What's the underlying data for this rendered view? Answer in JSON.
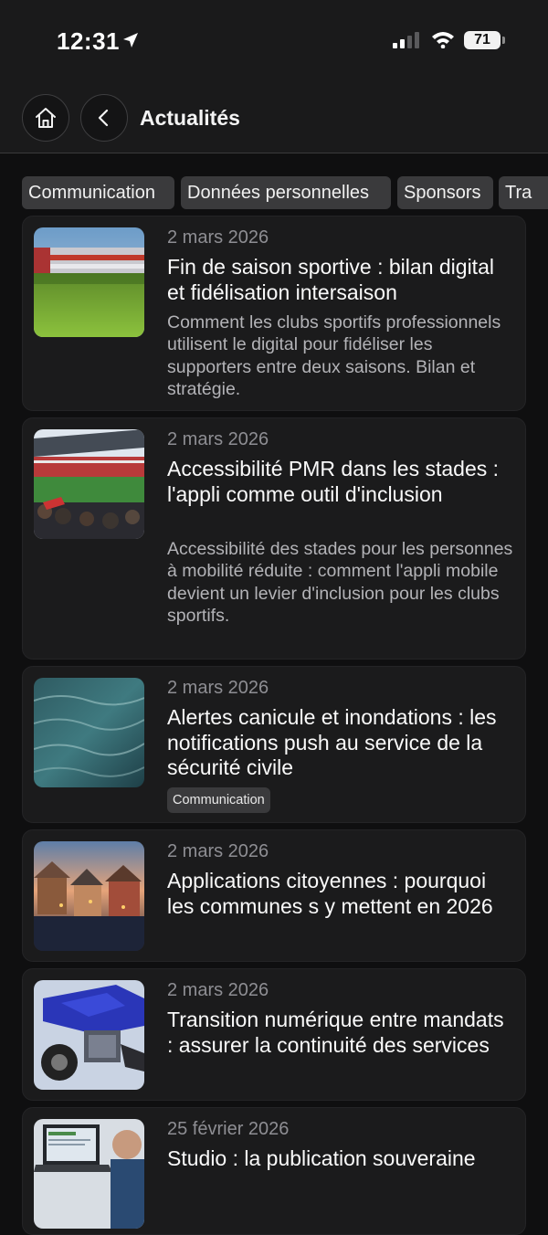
{
  "status_bar": {
    "time": "12:31",
    "battery": "71"
  },
  "header": {
    "title": "Actualités"
  },
  "filters": [
    "Communication",
    "Données personnelles",
    "Sponsors",
    "Tra"
  ],
  "articles": [
    {
      "date": "2 mars 2026",
      "title": "Fin de saison sportive : bilan digital et fidélisation intersaison",
      "description": "Comment les clubs sportifs professionnels utilisent le digital pour fidéliser les supporters entre deux saisons. Bilan et stratégie.",
      "tag": ""
    },
    {
      "date": "2 mars 2026",
      "title": "Accessibilité PMR dans les stades : l'appli comme outil d'inclusion",
      "description": "Accessibilité des stades pour les personnes à mobilité réduite : comment l'appli mobile devient un levier d'inclusion pour les clubs sportifs.",
      "tag": ""
    },
    {
      "date": "2 mars 2026",
      "title": "Alertes canicule et inondations : les notifications push au service de la sécurité civile",
      "description": "",
      "tag": "Communication"
    },
    {
      "date": "2 mars 2026",
      "title": "Applications citoyennes : pourquoi les communes s y mettent en 2026",
      "description": "",
      "tag": ""
    },
    {
      "date": "2 mars 2026",
      "title": "Transition numérique entre mandats : assurer la continuité des services",
      "description": "",
      "tag": ""
    },
    {
      "date": "25 février 2026",
      "title": "Studio : la publication souveraine",
      "description": "",
      "tag": ""
    }
  ]
}
